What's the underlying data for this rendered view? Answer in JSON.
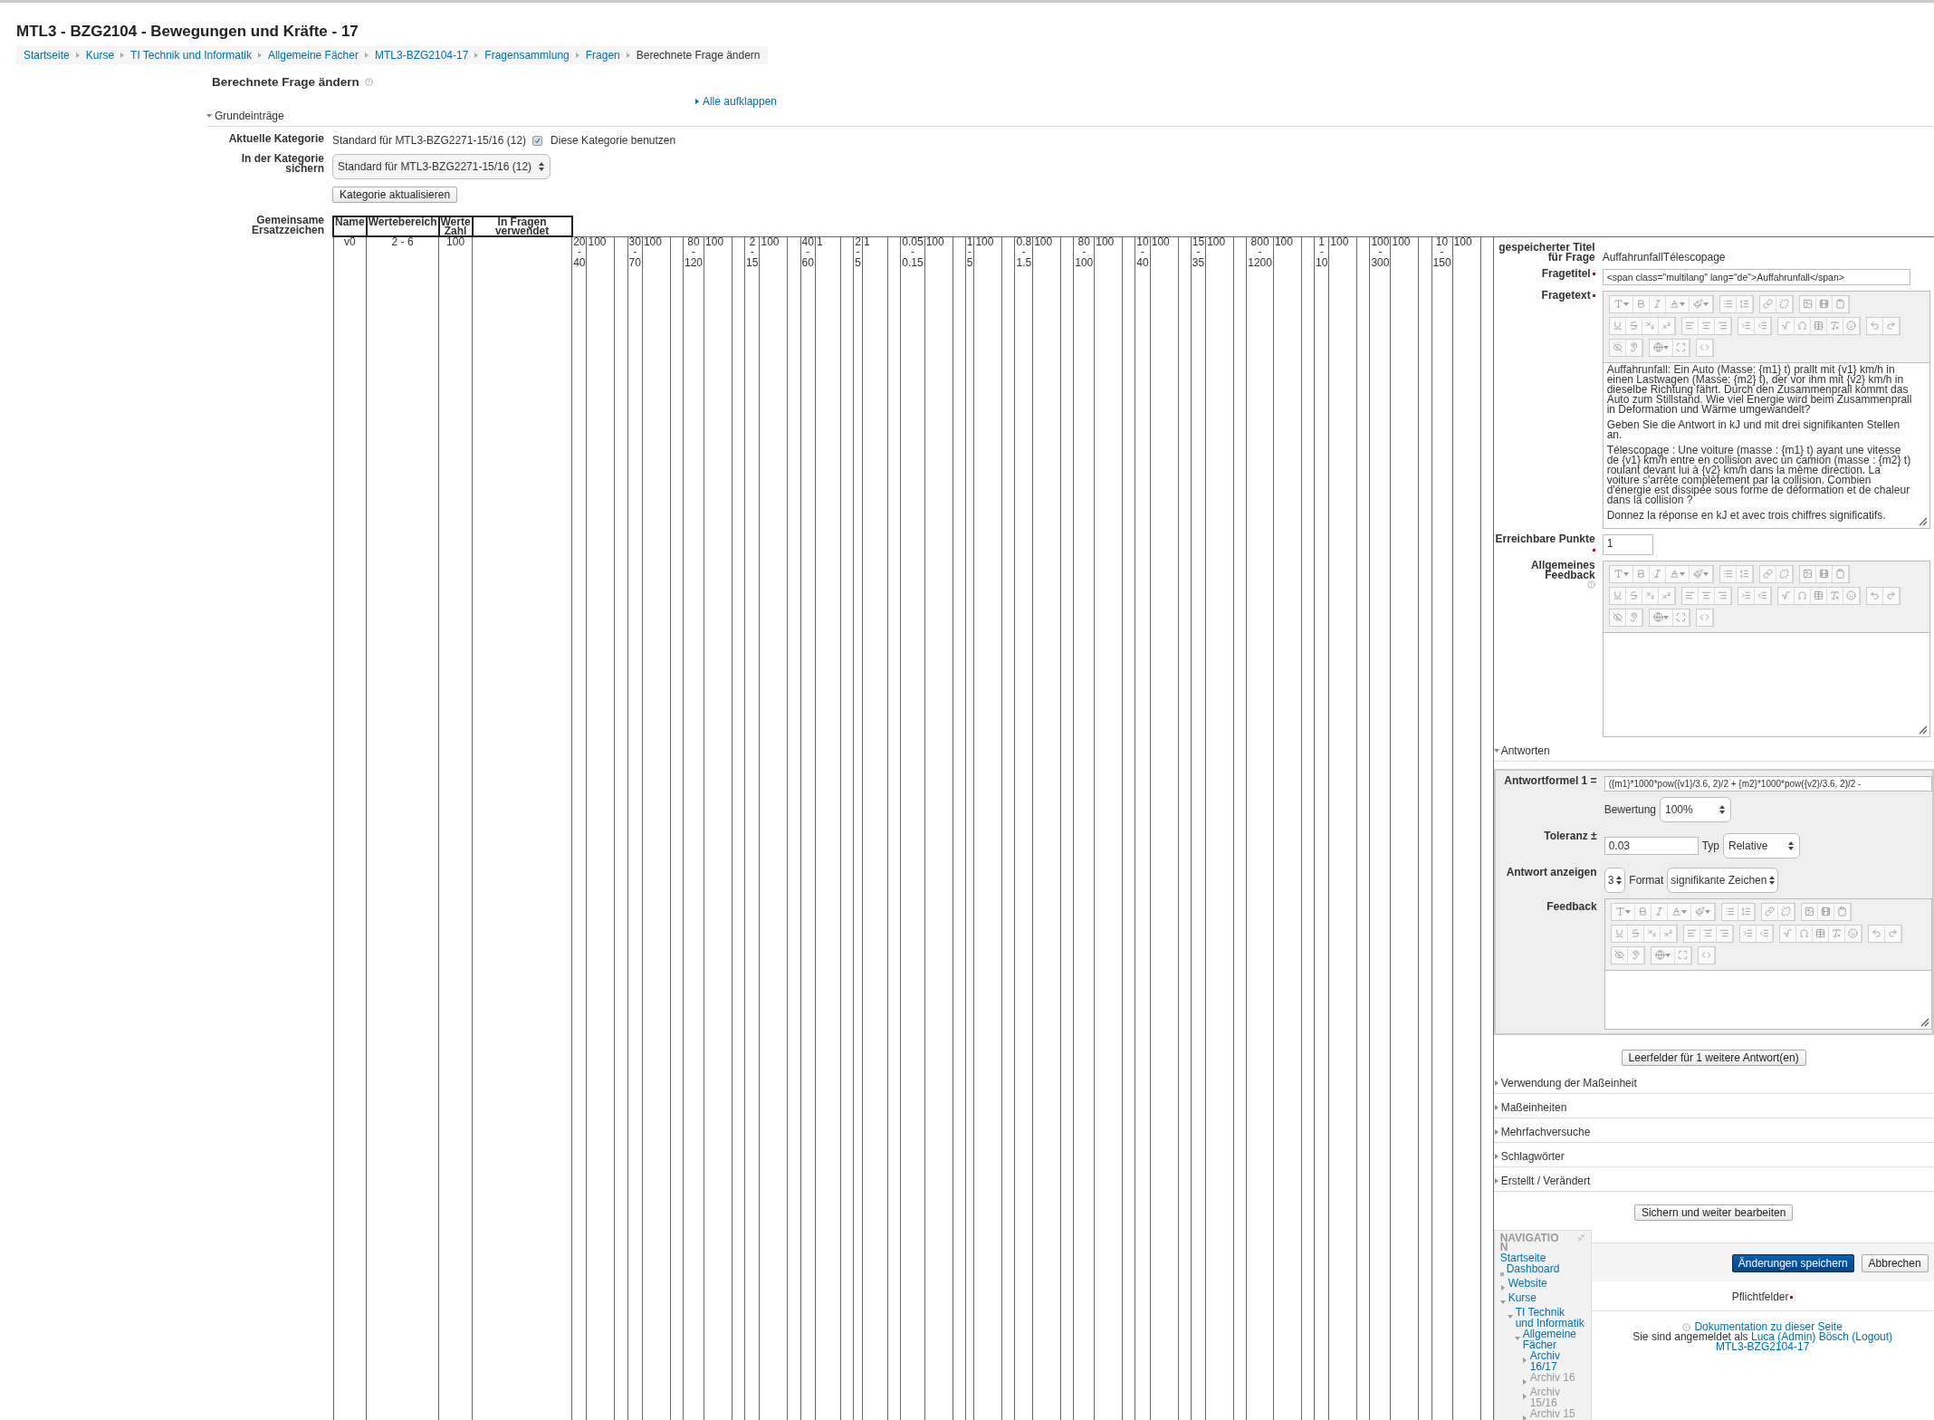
{
  "page_title": "MTL3 - BZG2104 - Bewegungen und Kräfte - 17",
  "breadcrumb": [
    {
      "label": "Startseite",
      "link": true
    },
    {
      "label": "Kurse",
      "link": true
    },
    {
      "label": "TI Technik und Informatik",
      "link": true
    },
    {
      "label": "Allgemeine Fächer",
      "link": true
    },
    {
      "label": "MTL3-BZG2104-17",
      "link": true
    },
    {
      "label": "Fragensammlung",
      "link": true
    },
    {
      "label": "Fragen",
      "link": true
    },
    {
      "label": "Berechnete Frage ändern",
      "link": false
    }
  ],
  "heading": "Berechnete Frage ändern",
  "expand_all": "Alle aufklappen",
  "general_section": {
    "legend": "Grundeinträge",
    "expanded": true
  },
  "current_category": {
    "label": "Aktuelle Kategorie",
    "value": "Standard für MTL3-BZG2271-15/16 (12)",
    "checked": true,
    "checkbox_label": "Diese Kategorie benutzen"
  },
  "save_in_category": {
    "label": "In der Kategorie sichern",
    "value": "Standard für MTL3-BZG2271-15/16 (12)"
  },
  "update_category_button": "Kategorie aktualisieren",
  "wildcards": {
    "label": "Gemeinsame Ersatzzeichen",
    "columns": [
      "Name",
      "Wertebereich",
      "Werte Zahl",
      "In Fragen verwendet"
    ],
    "row": {
      "name": "v0",
      "range": "2 - 6",
      "count": "100"
    },
    "extra": [
      {
        "range": "20 - 40",
        "count": "100"
      },
      {
        "range": "30 - 70",
        "count": "100"
      },
      {
        "range": "80 - 120",
        "count": "100"
      },
      {
        "range": "2 - 15",
        "count": "100"
      },
      {
        "range": "40 - 60",
        "count": "1"
      },
      {
        "range": "2 - 5",
        "count": "1"
      },
      {
        "range": "0.05 - 0.15",
        "count": "100"
      },
      {
        "range": "1 - 5",
        "count": "100"
      },
      {
        "range": "0.8 - 1.5",
        "count": "100"
      },
      {
        "range": "80 - 100",
        "count": "100"
      },
      {
        "range": "10 - 40",
        "count": "100"
      },
      {
        "range": "15 - 35",
        "count": "100"
      },
      {
        "range": "800 - 1200",
        "count": "100"
      },
      {
        "range": "1 - 10",
        "count": "100"
      },
      {
        "range": "100 - 300",
        "count": "100"
      },
      {
        "range": "10 - 150",
        "count": "100"
      }
    ]
  },
  "saved_title": {
    "label": "gespeicherter Titel für Frage",
    "value": "AuffahrunfallTélescopage"
  },
  "question_title": {
    "label": "Fragetitel",
    "required": true,
    "value": "<span class=\"multilang\" lang=\"de\">Auffahrunfall</span>"
  },
  "question_text": {
    "label": "Fragetext",
    "required": true,
    "paragraphs": [
      "Auffahrunfall: Ein Auto (Masse: {m1} t) prallt mit {v1} km/h in einen Lastwagen (Masse: {m2} t), der vor ihm mit {v2} km/h in dieselbe Richtung fährt. Durch den Zusammenprall kommt das Auto zum Stillstand. Wie viel Energie wird beim Zusammenprall in Deformation und Wärme umgewandelt?",
      "Geben Sie die Antwort in kJ und mit drei signifikanten Stellen an.",
      "Télescopage : Une voiture (masse : {m1} t) ayant une vitesse de {v1} km/h entre en collision avec un camion (masse : {m2} t) roulant devant lui à {v2} km/h dans la même direction. La voiture s'arrête complètement par la collision. Combien d'énergie est dissipée sous forme de déformation et de chaleur dans la collision ?",
      "Donnez la réponse en kJ et avec trois chiffres significatifs."
    ]
  },
  "max_points": {
    "label": "Erreichbare Punkte",
    "required": true,
    "value": "1"
  },
  "general_feedback": {
    "label": "Allgemeines Feedback"
  },
  "answers_section": {
    "legend": "Antworten",
    "expanded": true
  },
  "answer": {
    "formula_label": "Antwortformel 1 =",
    "formula": "({m1}*1000*pow({v1}/3.6, 2)/2 + {m2}*1000*pow({v2}/3.6, 2)/2 -",
    "grade_label": "Bewertung",
    "grade": "100%",
    "tolerance_label": "Toleranz ±",
    "tolerance": "0.03",
    "type_label": "Typ",
    "type": "Relative",
    "display_label": "Antwort anzeigen",
    "display": "3",
    "format_label": "Format",
    "format": "signifikante Zeichen",
    "feedback_label": "Feedback"
  },
  "add_answers_button": "Leerfelder für 1 weitere Antwort(en)",
  "collapsed_sections": [
    {
      "legend": "Verwendung der Maßeinheit",
      "expanded": false
    },
    {
      "legend": "Maßeinheiten",
      "expanded": false
    },
    {
      "legend": "Mehrfachversuche",
      "expanded": false
    },
    {
      "legend": "Schlagwörter",
      "expanded": false
    },
    {
      "legend": "Erstellt / Verändert",
      "expanded": false
    }
  ],
  "save_continue_button": "Sichern und weiter bearbeiten",
  "navigation": {
    "title": "NAVIGATION",
    "tree": [
      {
        "label": "Startseite",
        "kind": "root",
        "dimmed": false
      },
      {
        "label": "Dashboard",
        "kind": "leaf",
        "dimmed": false
      },
      {
        "label": "Website",
        "kind": "branch",
        "expanded": false,
        "dimmed": false
      },
      {
        "label": "Kurse",
        "kind": "branch",
        "expanded": true,
        "dimmed": false,
        "children": [
          {
            "label": "TI Technik und Informatik",
            "kind": "branch",
            "expanded": true,
            "dimmed": false,
            "children": [
              {
                "label": "Allgemeine Fächer",
                "kind": "branch",
                "expanded": true,
                "dimmed": false,
                "children": [
                  {
                    "label": "Archiv 16/17",
                    "kind": "branch",
                    "expanded": false,
                    "dimmed": false
                  },
                  {
                    "label": "Archiv 16",
                    "kind": "branch",
                    "expanded": false,
                    "dimmed": true
                  },
                  {
                    "label": "Archiv 15/16",
                    "kind": "branch",
                    "expanded": false,
                    "dimmed": true
                  },
                  {
                    "label": "Archiv 15",
                    "kind": "branch",
                    "expanded": false,
                    "dimmed": true
                  }
                ]
              }
            ]
          }
        ]
      }
    ]
  },
  "submit_button": "Änderungen speichern",
  "cancel_button": "Abbrechen",
  "required_note": "Pflichtfelder",
  "footer": {
    "doc_link": "Dokumentation zu dieser Seite",
    "logged_in_prefix": "Sie sind angemeldet als",
    "user": "Luca (Admin) Bösch",
    "logout": "(Logout)",
    "course": "MTL3-BZG2104-17"
  }
}
